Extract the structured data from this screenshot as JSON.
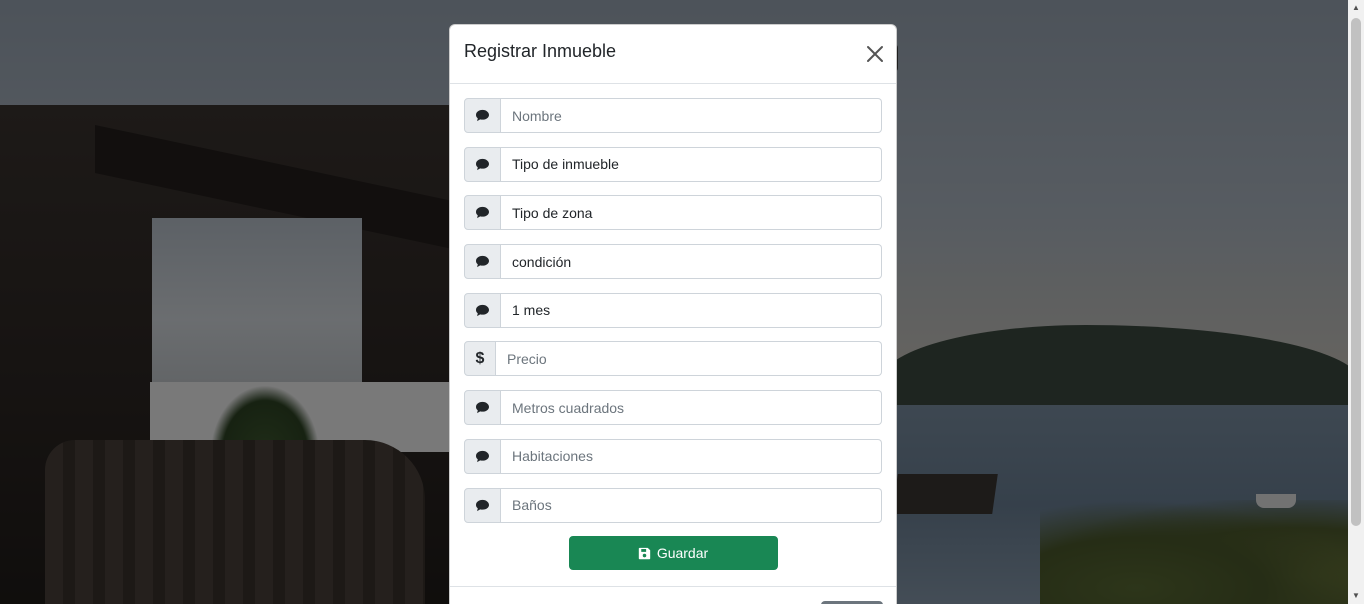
{
  "modal": {
    "title": "Registrar Inmueble",
    "close_icon": "close-icon"
  },
  "form": {
    "fields": [
      {
        "icon": "chat-icon",
        "placeholder": "Nombre",
        "value": ""
      },
      {
        "icon": "chat-icon",
        "placeholder": "Tipo de inmueble",
        "value": "Tipo de inmueble"
      },
      {
        "icon": "chat-icon",
        "placeholder": "Tipo de zona",
        "value": "Tipo de zona"
      },
      {
        "icon": "chat-icon",
        "placeholder": "condición",
        "value": "condición"
      },
      {
        "icon": "chat-icon",
        "placeholder": "1 mes",
        "value": "1 mes"
      },
      {
        "icon": "dollar-icon",
        "addon_text": "$",
        "placeholder": "Precio",
        "value": ""
      },
      {
        "icon": "chat-icon",
        "placeholder": "Metros cuadrados",
        "value": ""
      },
      {
        "icon": "chat-icon",
        "placeholder": "Habitaciones",
        "value": ""
      },
      {
        "icon": "chat-icon",
        "placeholder": "Baños",
        "value": ""
      }
    ],
    "save_label": "Guardar",
    "save_icon": "save-icon"
  },
  "colors": {
    "save_button": "#198754",
    "backdrop": "rgba(0,0,0,0.5)"
  }
}
